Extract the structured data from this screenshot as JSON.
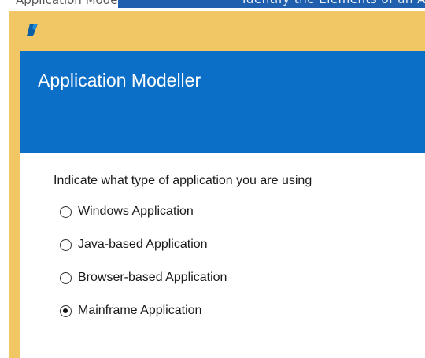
{
  "background_doc": {
    "text_left": "Application Modeller",
    "text_right": "Identify the Elements of an Application"
  },
  "window": {
    "app_icon": "blueprint-logo-icon",
    "frame_color": "#f1c765"
  },
  "header": {
    "title": "Application Modeller",
    "color": "#0c6fc7"
  },
  "form": {
    "prompt": "Indicate what type of application you are using",
    "options": [
      {
        "label": "Windows Application",
        "selected": false
      },
      {
        "label": "Java-based Application",
        "selected": false
      },
      {
        "label": "Browser-based Application",
        "selected": false
      },
      {
        "label": "Mainframe Application",
        "selected": true
      }
    ]
  }
}
